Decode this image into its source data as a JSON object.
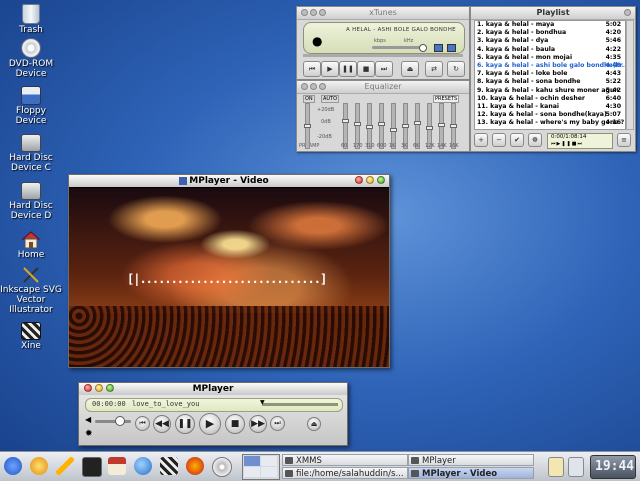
{
  "desktop_icons": [
    {
      "label": "Trash"
    },
    {
      "label": "DVD-ROM Device"
    },
    {
      "label": "Floppy Device"
    },
    {
      "label": "Hard Disc Device C"
    },
    {
      "label": "Hard Disc Device D"
    },
    {
      "label": "Home"
    },
    {
      "label": "Inkscape SVG Vector Illustrator"
    },
    {
      "label": "Xine"
    }
  ],
  "xtunes": {
    "title": "xTunes",
    "track_scroll": "A HELAL - ASHI BOLE GALO BONDHE",
    "kbps": "kbps",
    "khz": "kHz"
  },
  "equalizer": {
    "title": "Equalizer",
    "on_label": "ON",
    "auto_label": "AUTO",
    "presets_label": "PRESETS",
    "db_labels": [
      "+20dB",
      "0dB",
      "-20dB"
    ],
    "preamp_label": "PREAMP",
    "bands": [
      "60",
      "170",
      "310",
      "600",
      "1K",
      "3K",
      "6K",
      "12K",
      "14K",
      "16K"
    ],
    "levels": [
      0.5,
      0.38,
      0.46,
      0.52,
      0.44,
      0.6,
      0.5,
      0.42,
      0.54,
      0.48,
      0.5
    ]
  },
  "playlist": {
    "title": "Playlist",
    "items": [
      {
        "label": "1. kaya & helal - maya",
        "time": "5:02"
      },
      {
        "label": "2. kaya & helal - bondhua",
        "time": "4:20"
      },
      {
        "label": "3. kaya & helal - dya",
        "time": "5:46"
      },
      {
        "label": "4. kaya & helal - baula",
        "time": "4:22"
      },
      {
        "label": "5. kaya & helal - mon mojai",
        "time": "4:35"
      },
      {
        "label": "6. kaya & helal - ashi bole galo bondhe(kr...",
        "time": "4:49"
      },
      {
        "label": "7. kaya & helal - loke bole",
        "time": "4:43"
      },
      {
        "label": "8. kaya & helal - sona bondhe",
        "time": "5:22"
      },
      {
        "label": "9. kaya & helal - kahu shure moner agun",
        "time": "5:42"
      },
      {
        "label": "10. kaya & helal - ochin desher",
        "time": "6:40"
      },
      {
        "label": "11. kaya & helal - kanai",
        "time": "4:30"
      },
      {
        "label": "12. kaya & helal - sona bondhe(kaya)",
        "time": "5:07"
      },
      {
        "label": "13. kaya & helal - where's my baby gone ?",
        "time": "4:16"
      }
    ],
    "active_index": 5,
    "time_total": "0:00/1:08:14",
    "colors": {
      "active": "#1f5fd0",
      "normal": "#000000"
    }
  },
  "video": {
    "title": "MPlayer - Video",
    "osd": "[|.............................]"
  },
  "mplayer": {
    "title": "MPlayer",
    "time": "00:00:00",
    "filename": "love_to_love_you"
  },
  "taskbar": {
    "tasks": [
      {
        "label": "XMMS"
      },
      {
        "label": "MPlayer"
      },
      {
        "label": "file:/home/salahuddin/s..."
      },
      {
        "label": "MPlayer - Video"
      }
    ],
    "clock": "19:44"
  }
}
